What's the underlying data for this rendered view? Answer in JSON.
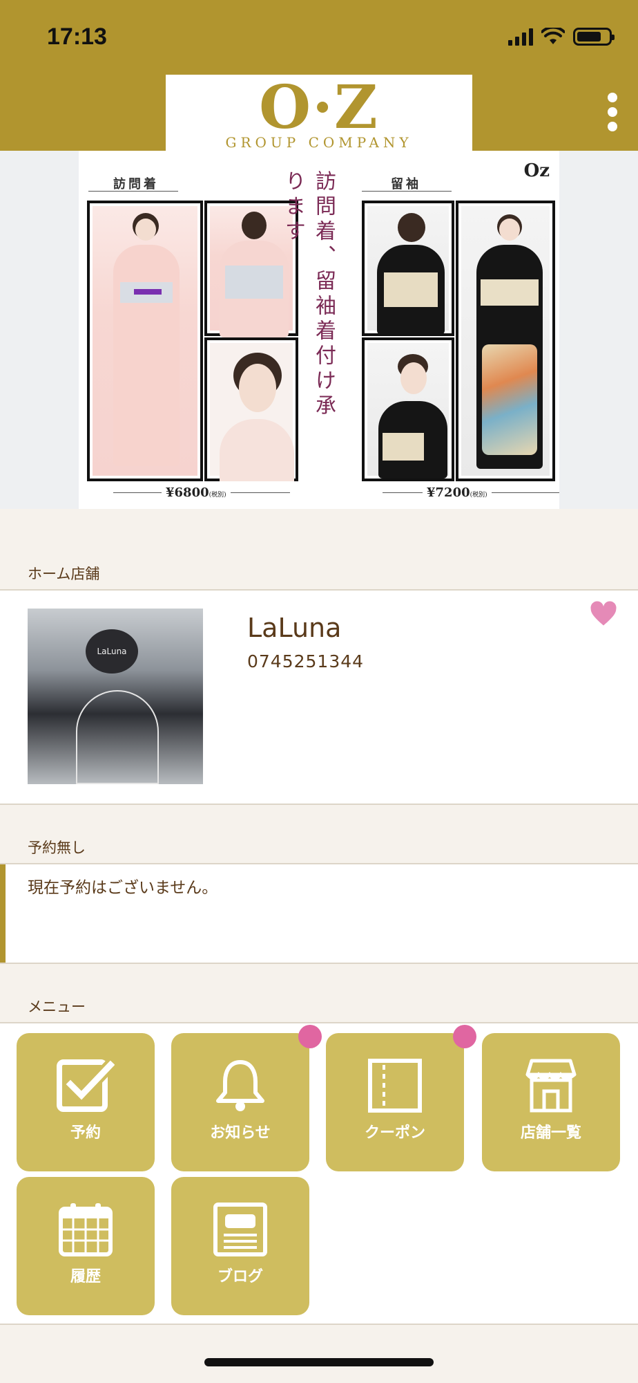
{
  "status": {
    "time": "17:13"
  },
  "header": {
    "logo_main": "O·Z",
    "logo_sub": "GROUP COMPANY",
    "menu_icon": "more-vertical-icon",
    "bg_color": "#b1952f"
  },
  "banner": {
    "left_label": "訪問着",
    "right_label": "留袖",
    "headline": "訪問着、留袖着付け承ります",
    "brand_mini": "Oz",
    "left_price": "¥6800",
    "right_price": "¥7200",
    "tax_note": "(税別)"
  },
  "home_store": {
    "section_title": "ホーム店舗",
    "name": "LaLuna",
    "phone": "0745251344",
    "sign_text": "LaLuna",
    "favorite_icon": "heart-icon"
  },
  "reservation": {
    "section_title": "予約無し",
    "message": "現在予約はございません。"
  },
  "menu": {
    "section_title": "メニュー",
    "items": [
      {
        "label": "予約",
        "icon": "checkbox-icon",
        "badge": false
      },
      {
        "label": "お知らせ",
        "icon": "bell-icon",
        "badge": true
      },
      {
        "label": "クーポン",
        "icon": "coupon-icon",
        "badge": true
      },
      {
        "label": "店舗一覧",
        "icon": "store-icon",
        "badge": false
      },
      {
        "label": "履歴",
        "icon": "calendar-icon",
        "badge": false
      },
      {
        "label": "ブログ",
        "icon": "blog-icon",
        "badge": false
      }
    ],
    "tile_color": "#cfbd5f",
    "badge_color": "#e066a1"
  }
}
